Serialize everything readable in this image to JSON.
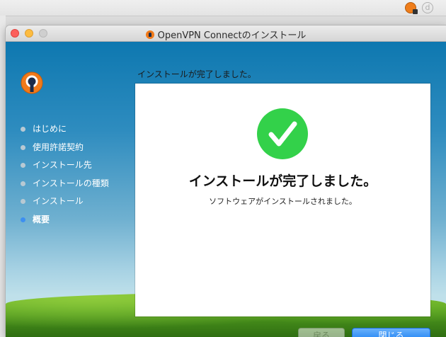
{
  "window": {
    "title": "OpenVPN Connectのインストール"
  },
  "steps": [
    {
      "label": "はじめに",
      "state": "done"
    },
    {
      "label": "使用許諾契約",
      "state": "done"
    },
    {
      "label": "インストール先",
      "state": "done"
    },
    {
      "label": "インストールの種類",
      "state": "done"
    },
    {
      "label": "インストール",
      "state": "done"
    },
    {
      "label": "概要",
      "state": "current"
    }
  ],
  "header_text": "インストールが完了しました。",
  "panel": {
    "title": "インストールが完了しました。",
    "subtitle": "ソフトウェアがインストールされました。",
    "icon": "checkmark-icon"
  },
  "buttons": {
    "back_label": "戻る",
    "close_label": "閉じる"
  },
  "toolbar": {
    "extension_icon_2_label": "d"
  },
  "colors": {
    "accent": "#1c7ff3",
    "success": "#33d14a",
    "brand": "#f07a1a"
  }
}
